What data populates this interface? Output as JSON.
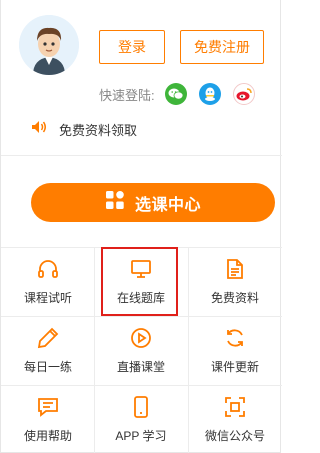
{
  "user": {
    "login_label": "登录",
    "register_label": "免费注册",
    "quick_login_label": "快速登陆:",
    "social_icons": [
      "wechat-icon",
      "qq-icon",
      "weibo-icon"
    ]
  },
  "free_materials": {
    "label": "免费资料领取"
  },
  "course_center": {
    "label": "选课中心"
  },
  "grid": {
    "items": [
      {
        "label": "课程试听",
        "icon": "headphones-icon"
      },
      {
        "label": "在线题库",
        "icon": "monitor-icon"
      },
      {
        "label": "免费资料",
        "icon": "document-icon"
      },
      {
        "label": "每日一练",
        "icon": "pencil-icon"
      },
      {
        "label": "直播课堂",
        "icon": "play-icon"
      },
      {
        "label": "课件更新",
        "icon": "refresh-icon"
      },
      {
        "label": "使用帮助",
        "icon": "chat-icon"
      },
      {
        "label": "APP 学习",
        "icon": "phone-icon"
      },
      {
        "label": "微信公众号",
        "icon": "scan-icon"
      }
    ]
  },
  "colors": {
    "accent": "#ff7d00",
    "highlight_border": "#e0201a",
    "divider": "#ececec"
  }
}
